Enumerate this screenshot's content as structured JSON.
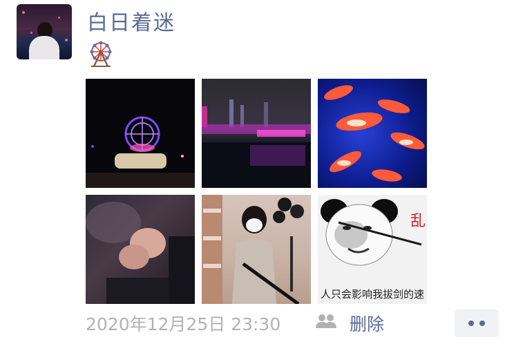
{
  "post": {
    "author": "白日着迷",
    "meme_caption": "人只会影响我拔剑的速",
    "meme_mark": "乱",
    "timestamp": "2020年12月25日 23:30",
    "delete_label": "删除"
  },
  "colors": {
    "link": "#576b95",
    "meta_text": "#b2b2b2",
    "more_button_bg": "#f1f2f5"
  },
  "icons": {
    "emoji": "ferris-wheel-icon",
    "visibility": "friends-icon",
    "more": "more-dots-icon"
  }
}
